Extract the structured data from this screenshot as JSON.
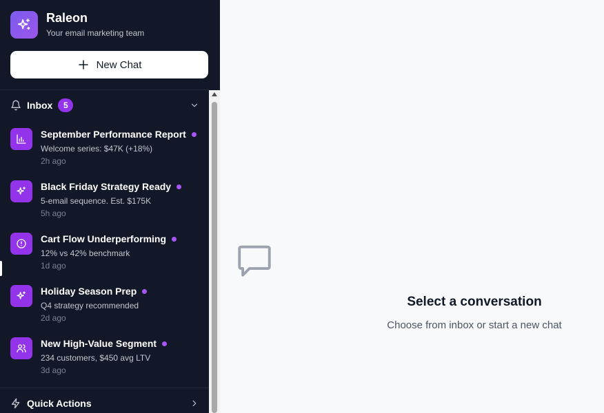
{
  "brand": {
    "name": "Raleon",
    "tagline": "Your email marketing team",
    "icon": "sparkles-icon",
    "gradient": [
      "#7c5cf0",
      "#9b55e8"
    ]
  },
  "new_chat": {
    "label": "New Chat",
    "icon": "plus-icon"
  },
  "inbox": {
    "title": "Inbox",
    "count": "5",
    "badge_color": "#9333ea",
    "items": [
      {
        "icon": "bar-chart-icon",
        "title": "September Performance Report",
        "desc": "Welcome series: $47K (+18%)",
        "time": "2h ago",
        "unread": true
      },
      {
        "icon": "sparkles-icon",
        "title": "Black Friday Strategy Ready",
        "desc": "5-email sequence. Est. $175K",
        "time": "5h ago",
        "unread": true
      },
      {
        "icon": "alert-circle-icon",
        "title": "Cart Flow Underperforming",
        "desc": "12% vs 42% benchmark",
        "time": "1d ago",
        "unread": true
      },
      {
        "icon": "sparkles-icon",
        "title": "Holiday Season Prep",
        "desc": "Q4 strategy recommended",
        "time": "2d ago",
        "unread": true
      },
      {
        "icon": "users-icon",
        "title": "New High-Value Segment",
        "desc": "234 customers, $450 avg LTV",
        "time": "3d ago",
        "unread": true
      }
    ]
  },
  "quick_actions": {
    "label": "Quick Actions"
  },
  "main": {
    "title": "Select a conversation",
    "subtitle": "Choose from inbox or start a new chat",
    "icon": "message-square-icon"
  },
  "colors": {
    "sidebar_bg": "#121827",
    "accent": "#9333ea",
    "dot": "#a855f7",
    "main_bg": "#f8f9fb"
  }
}
